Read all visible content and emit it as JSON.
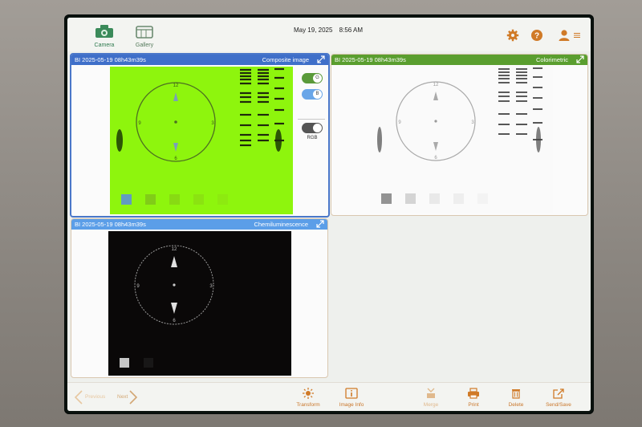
{
  "header": {
    "tabs": [
      {
        "label": "Camera",
        "icon": "camera-icon"
      },
      {
        "label": "Gallery",
        "icon": "gallery-icon"
      }
    ],
    "date": "May 19, 2025",
    "time": "8:56 AM",
    "icons": [
      "settings-gear-icon",
      "help-question-icon",
      "user-icon",
      "menu-icon"
    ]
  },
  "panels": {
    "composite": {
      "title": "BI 2025-05-19 08h43m39s",
      "mode": "Composite image",
      "header_color": "#3f6fc9",
      "image_color": "#8ef50d",
      "toggles": [
        {
          "label": "G",
          "state": "on",
          "color": "#5a9a3a"
        },
        {
          "label": "B",
          "state": "on",
          "color": "#6aa6e8"
        }
      ],
      "rgb_toggle": {
        "label": "RGB",
        "state": "on",
        "color": "#555"
      }
    },
    "colorimetric": {
      "title": "BI 2025-05-19 08h43m39s",
      "mode": "Colorimetric",
      "header_color": "#5a9e2f"
    },
    "chemi": {
      "title": "BI 2025-05-19 08h43m39s",
      "mode": "Chemiluminescence",
      "header_color": "#5b9ee8"
    }
  },
  "clock_numbers": {
    "twelve": "12",
    "three": "3",
    "six": "6",
    "nine": "9"
  },
  "footer": {
    "previous": "Previous",
    "next": "Next",
    "buttons": [
      {
        "label": "Transform",
        "icon": "transform-icon",
        "enabled": true
      },
      {
        "label": "Image Info",
        "icon": "image-info-icon",
        "enabled": true
      },
      {
        "label": "Merge",
        "icon": "merge-icon",
        "enabled": false
      },
      {
        "label": "Print",
        "icon": "print-icon",
        "enabled": true
      },
      {
        "label": "Delete",
        "icon": "delete-icon",
        "enabled": true
      },
      {
        "label": "Send/Save",
        "icon": "send-save-icon",
        "enabled": true
      }
    ]
  },
  "colors": {
    "accent": "#d07a27",
    "active_border": "#4a77c9"
  }
}
